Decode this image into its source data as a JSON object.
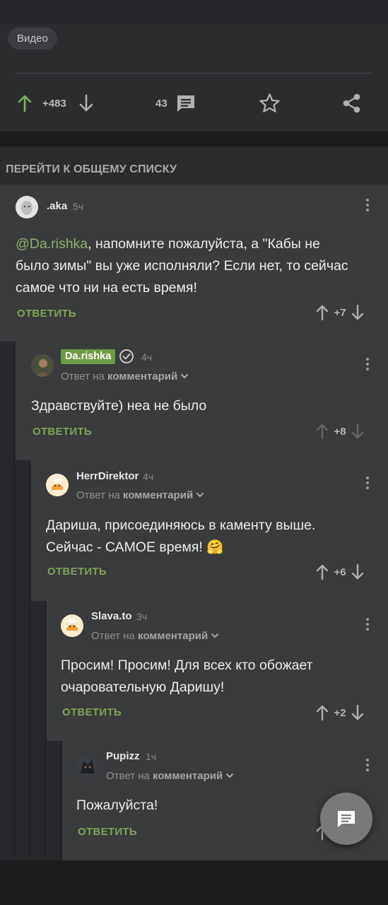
{
  "post": {
    "tag": "Видео",
    "rating": "+483",
    "comments_count": "43"
  },
  "comments_section": {
    "goto_list": "ПЕРЕЙТИ К ОБЩЕМУ СПИСКУ",
    "reply_prefix": "Ответ на",
    "reply_target": "комментарий",
    "answer_label": "ОТВЕТИТЬ"
  },
  "comments": [
    {
      "user": ".aka",
      "time": "5ч",
      "mention": "@Da.rishka",
      "text": ", напомните пожалуйста, а \"Кабы не было зимы\" вы уже исполняли? Если нет, то сейчас самое что ни на есть время!",
      "score": "+7"
    },
    {
      "user": "Da.rishka",
      "time": "4ч",
      "text": "Здравствуйте) неа не было",
      "score": "+8"
    },
    {
      "user": "HerrDirektor",
      "time": "4ч",
      "text": "Дариша, присоединяюсь в каменту выше. Сейчас - САМОЕ время! 🤗",
      "score": "+6"
    },
    {
      "user": "Slava.to",
      "time": "3ч",
      "text": "Просим! Просим! Для всех кто обожает очаровательную Даришу!",
      "score": "+2"
    },
    {
      "user": "Pupizz",
      "time": "1ч",
      "text": "Пожалуйста!",
      "score": ""
    }
  ],
  "colors": {
    "accent_green": "#7fa35a",
    "author_badge": "#6d9a45",
    "upvote_green": "#7fb35a"
  },
  "icons": [
    "arrow-up-icon",
    "arrow-down-icon",
    "comment-icon",
    "star-icon",
    "share-icon",
    "more-icon",
    "verified-icon",
    "chevron-down-icon",
    "chat-icon"
  ]
}
